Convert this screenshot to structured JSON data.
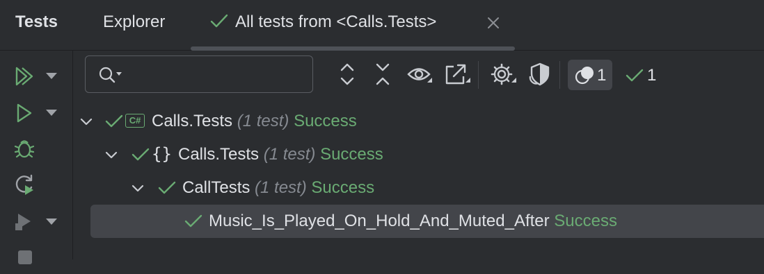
{
  "tool_window": {
    "title": "Tests",
    "tabs": [
      {
        "label": "Explorer"
      },
      {
        "label": "All tests from <Calls.Tests>",
        "active": true
      }
    ]
  },
  "search": {
    "placeholder": "",
    "value": ""
  },
  "toolbar": {
    "icons": [
      "expand-all-icon",
      "collapse-all-icon",
      "show-hidden-icon",
      "export-icon",
      "settings-icon",
      "coverage-icon"
    ],
    "ignored_filter_count": "1",
    "passed_count": "1"
  },
  "tree": [
    {
      "name": "Calls.Tests",
      "badge": "C#",
      "count": "(1 test)",
      "status": "Success"
    },
    {
      "name": "Calls.Tests",
      "badge": "{}",
      "count": "(1 test)",
      "status": "Success"
    },
    {
      "name": "CallTests",
      "count": "(1 test)",
      "status": "Success"
    },
    {
      "name": "Music_Is_Played_On_Hold_And_Muted_After",
      "status": "Success",
      "selected": true
    }
  ],
  "colors": {
    "background": "#2b2d30",
    "success": "#6aab73",
    "selection": "#43454a",
    "muted": "#868a91"
  }
}
